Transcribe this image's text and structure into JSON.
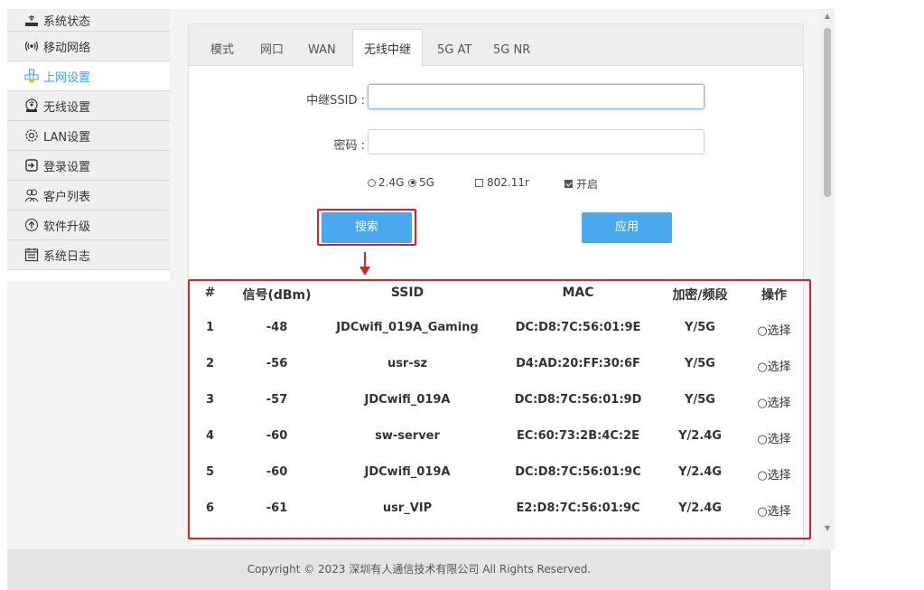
{
  "sidebar": {
    "items": [
      {
        "label": "系统状态",
        "icon": "system-status-icon"
      },
      {
        "label": "移动网络",
        "icon": "mobile-network-icon"
      },
      {
        "label": "上网设置",
        "icon": "internet-settings-icon"
      },
      {
        "label": "无线设置",
        "icon": "wireless-ap-icon"
      },
      {
        "label": "LAN设置",
        "icon": "gear-icon"
      },
      {
        "label": "登录设置",
        "icon": "login-icon"
      },
      {
        "label": "客户列表",
        "icon": "users-icon"
      },
      {
        "label": "软件升级",
        "icon": "upgrade-icon"
      },
      {
        "label": "系统日志",
        "icon": "log-icon"
      }
    ],
    "active_index": 2
  },
  "tabs": [
    "模式",
    "网口",
    "WAN",
    "无线中继",
    "5G AT",
    "5G NR"
  ],
  "active_tab": "无线中继",
  "form": {
    "ssid_label": "中继SSID :",
    "ssid_value": "",
    "password_label": "密码 :",
    "password_value": "",
    "band_24_label": "2.4G",
    "band_5_label": "5G",
    "band_selected": "5G",
    "roaming_label": "802.11r",
    "roaming_checked": false,
    "enable_label": "开启",
    "enable_checked": true
  },
  "buttons": {
    "search": "搜索",
    "apply": "应用"
  },
  "table": {
    "headers": [
      "#",
      "信号(dBm)",
      "SSID",
      "MAC",
      "加密/频段",
      "操作"
    ],
    "rows": [
      {
        "num": "1",
        "signal": "-48",
        "ssid": "JDCwifi_019A_Gaming",
        "mac": "DC:D8:7C:56:01:9E",
        "enc": "Y/5G",
        "action": "○选择"
      },
      {
        "num": "2",
        "signal": "-56",
        "ssid": "usr-sz",
        "mac": "D4:AD:20:FF:30:6F",
        "enc": "Y/5G",
        "action": "○选择"
      },
      {
        "num": "3",
        "signal": "-57",
        "ssid": "JDCwifi_019A",
        "mac": "DC:D8:7C:56:01:9D",
        "enc": "Y/5G",
        "action": "○选择"
      },
      {
        "num": "4",
        "signal": "-60",
        "ssid": "sw-server",
        "mac": "EC:60:73:2B:4C:2E",
        "enc": "Y/2.4G",
        "action": "○选择"
      },
      {
        "num": "5",
        "signal": "-60",
        "ssid": "JDCwifi_019A",
        "mac": "DC:D8:7C:56:01:9C",
        "enc": "Y/2.4G",
        "action": "○选择"
      },
      {
        "num": "6",
        "signal": "-61",
        "ssid": "usr_VIP",
        "mac": "E2:D8:7C:56:01:9C",
        "enc": "Y/2.4G",
        "action": "○选择"
      }
    ]
  },
  "footer": "Copyright © 2023 深圳有人通信技术有限公司 All Rights Reserved.",
  "colors": {
    "accent": "#4aa8ee",
    "active_text": "#3aa0e8",
    "highlight": "#e02020"
  }
}
